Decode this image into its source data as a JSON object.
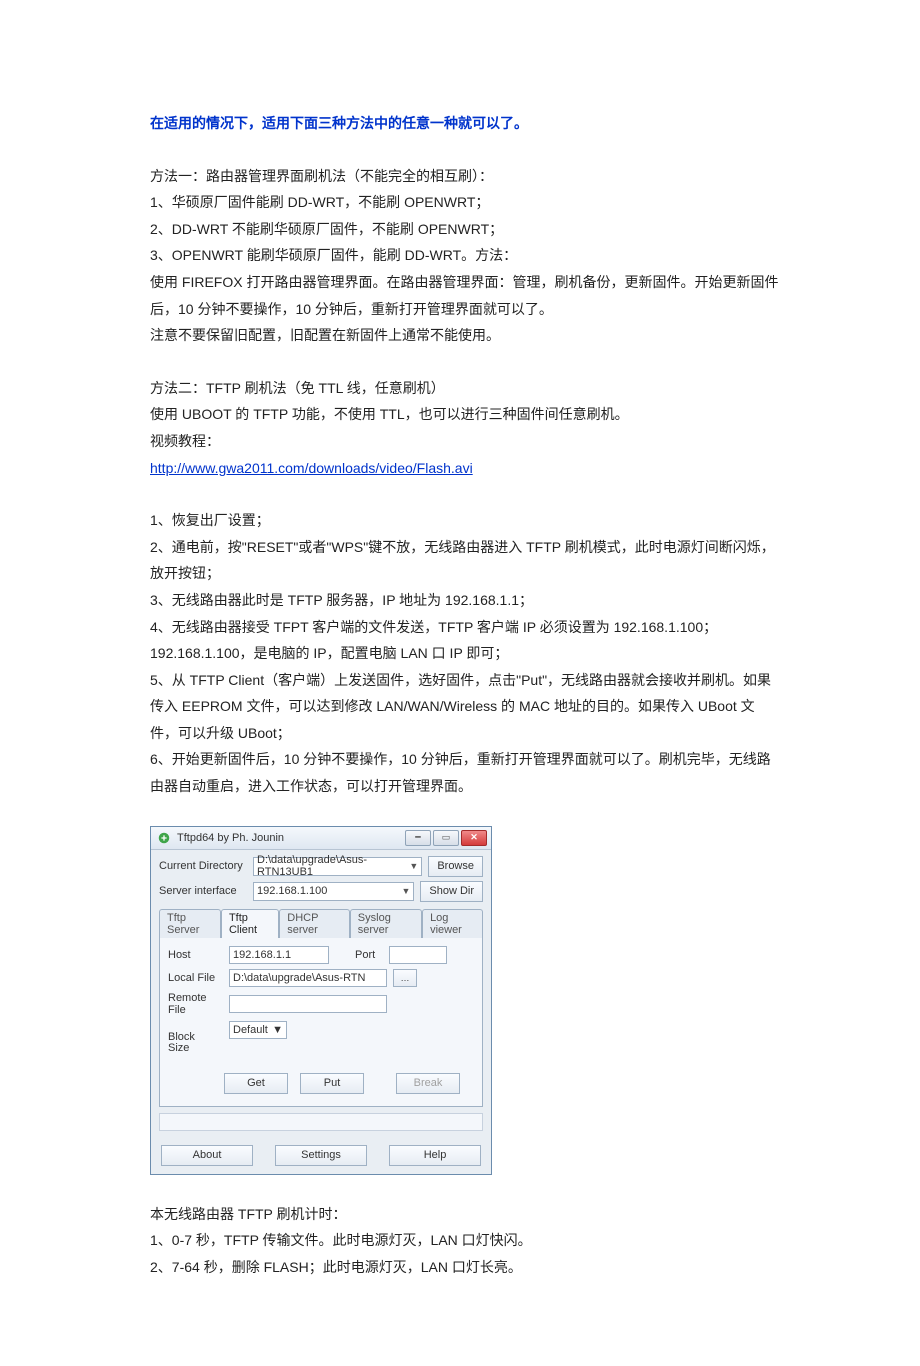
{
  "doc": {
    "title": "在适用的情况下，适用下面三种方法中的任意一种就可以了。",
    "m1_head": "方法一：路由器管理界面刷机法（不能完全的相互刷）：",
    "m1_1": "1、华硕原厂固件能刷 DD-WRT，不能刷 OPENWRT；",
    "m1_2": "2、DD-WRT 不能刷华硕原厂固件，不能刷 OPENWRT；",
    "m1_3": "3、OPENWRT 能刷华硕原厂固件，能刷 DD-WRT。方法：",
    "m1_4": "使用 FIREFOX 打开路由器管理界面。在路由器管理界面：管理，刷机备份，更新固件。开始更新固件后，10 分钟不要操作，10 分钟后，重新打开管理界面就可以了。",
    "m1_5": "注意不要保留旧配置，旧配置在新固件上通常不能使用。",
    "m2_head": "方法二：TFTP 刷机法（免 TTL 线，任意刷机）",
    "m2_1": "使用 UBOOT 的 TFTP 功能，不使用 TTL，也可以进行三种固件间任意刷机。",
    "m2_2": "视频教程：",
    "m2_link": "http://www.gwa2011.com/downloads/video/Flash.avi",
    "s1": "1、恢复出厂设置；",
    "s2": "2、通电前，按\"RESET\"或者\"WPS\"键不放，无线路由器进入 TFTP 刷机模式，此时电源灯间断闪烁，放开按钮；",
    "s3": "3、无线路由器此时是 TFTP 服务器，IP 地址为 192.168.1.1；",
    "s4": "4、无线路由器接受 TFPT 客户端的文件发送，TFTP 客户端 IP 必须设置为 192.168.1.100；192.168.1.100，是电脑的 IP，配置电脑 LAN 口 IP 即可；",
    "s5": "5、从 TFTP Client（客户端）上发送固件，选好固件，点击\"Put\"，无线路由器就会接收并刷机。如果传入 EEPROM 文件，可以达到修改 LAN/WAN/Wireless 的 MAC 地址的目的。如果传入 UBoot 文件，可以升级 UBoot；",
    "s6": "6、开始更新固件后，10 分钟不要操作，10 分钟后，重新打开管理界面就可以了。刷机完毕，无线路由器自动重启，进入工作状态，可以打开管理界面。",
    "timing_head": "本无线路由器 TFTP 刷机计时：",
    "t1": "1、0-7 秒，TFTP 传输文件。此时电源灯灭，LAN 口灯快闪。",
    "t2": "2、7-64 秒，删除 FLASH；此时电源灯灭，LAN 口灯长亮。"
  },
  "app": {
    "title": "Tftpd64 by Ph. Jounin",
    "labels": {
      "curdir": "Current Directory",
      "serverif": "Server interface",
      "browse": "Browse",
      "showdir": "Show Dir",
      "host": "Host",
      "port": "Port",
      "localfile": "Local File",
      "remotefile": "Remote File",
      "blocksize": "Block\nSize",
      "get": "Get",
      "put": "Put",
      "break": "Break",
      "about": "About",
      "settings": "Settings",
      "help": "Help"
    },
    "values": {
      "curdir": "D:\\data\\upgrade\\Asus-RTN13UB1",
      "serverif": "192.168.1.100",
      "host": "192.168.1.1",
      "port": "",
      "localfile": "D:\\data\\upgrade\\Asus-RTN",
      "remotefile": "",
      "blocksize": "Default"
    },
    "tabs": [
      "Tftp Server",
      "Tftp Client",
      "DHCP server",
      "Syslog server",
      "Log viewer"
    ],
    "active_tab": 1
  }
}
